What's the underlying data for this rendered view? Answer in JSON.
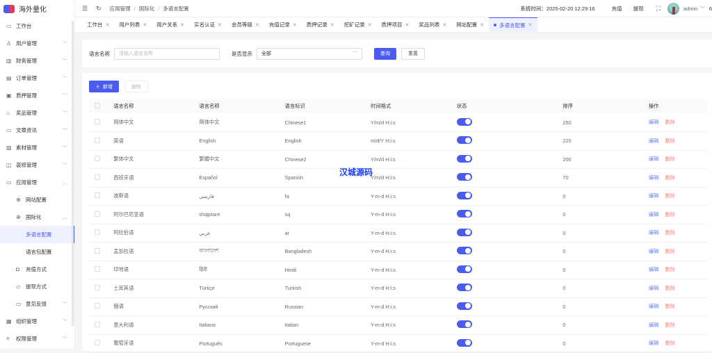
{
  "app": {
    "title": "海外量化"
  },
  "sidebar": {
    "items": [
      {
        "label": "工作台",
        "icon": "monitor-icon",
        "glyph": "▭",
        "level": 1
      },
      {
        "label": "用户管理",
        "icon": "user-icon",
        "glyph": "♙",
        "level": 1,
        "chev": "﹀"
      },
      {
        "label": "财务管理",
        "icon": "finance-icon",
        "glyph": "▥",
        "level": 1,
        "chev": "﹀"
      },
      {
        "label": "订单管理",
        "icon": "order-icon",
        "glyph": "▤",
        "level": 1,
        "chev": "﹀"
      },
      {
        "label": "质押管理",
        "icon": "pledge-icon",
        "glyph": "▣",
        "level": 1,
        "chev": "﹀"
      },
      {
        "label": "奖品管理",
        "icon": "bag-icon",
        "glyph": "⌂",
        "level": 1,
        "chev": "﹀"
      },
      {
        "label": "文章资讯",
        "icon": "article-icon",
        "glyph": "▭",
        "level": 1,
        "chev": "﹀"
      },
      {
        "label": "素材管理",
        "icon": "image-icon",
        "glyph": "▨",
        "level": 1,
        "chev": "﹀"
      },
      {
        "label": "装修管理",
        "icon": "decor-icon",
        "glyph": "◫",
        "level": 1,
        "chev": "﹀"
      },
      {
        "label": "应用管理",
        "icon": "app-icon",
        "glyph": "▭",
        "level": 1,
        "chev": "︿"
      },
      {
        "label": "网站配置",
        "icon": "globe-icon",
        "glyph": "⊕",
        "level": 2
      },
      {
        "label": "国际化",
        "icon": "globe-icon",
        "glyph": "⊕",
        "level": 2,
        "chev": "︿"
      },
      {
        "label": "多语言配置",
        "level": 3,
        "active": true
      },
      {
        "label": "语言包配置",
        "level": 3
      },
      {
        "label": "充值方式",
        "icon": "recharge-icon",
        "glyph": "◘",
        "level": 2
      },
      {
        "label": "提现方式",
        "icon": "folder-icon",
        "glyph": "▱",
        "level": 2
      },
      {
        "label": "意见反馈",
        "icon": "feedback-icon",
        "glyph": "▭",
        "level": 2,
        "chev": "﹀"
      },
      {
        "label": "组织管理",
        "icon": "org-icon",
        "glyph": "▦",
        "level": 1,
        "chev": "﹀"
      },
      {
        "label": "权限管理",
        "icon": "lock-icon",
        "glyph": "⍟",
        "level": 1,
        "chev": "﹀"
      }
    ]
  },
  "header": {
    "breadcrumb": [
      "应用管理",
      "国际化",
      "多语言配置"
    ],
    "system_time_label": "系统时间：",
    "system_time": "2025-02-20 12:29:16",
    "recharge": "充值",
    "withdraw": "提现",
    "user": "admin",
    "cut": "6"
  },
  "tabs": [
    {
      "label": "工作台"
    },
    {
      "label": "用户列表"
    },
    {
      "label": "用户关系"
    },
    {
      "label": "实名认证"
    },
    {
      "label": "会员等级"
    },
    {
      "label": "充值记录"
    },
    {
      "label": "质押记录"
    },
    {
      "label": "挖矿记录"
    },
    {
      "label": "质押项目"
    },
    {
      "label": "奖品列表"
    },
    {
      "label": "网站配置"
    },
    {
      "label": "多语言配置",
      "active": true
    }
  ],
  "search": {
    "name_label": "语言名称",
    "name_placeholder": "请输入语言名称",
    "show_label": "是否显示",
    "show_value": "全部",
    "query": "查询",
    "reset": "重置"
  },
  "toolbar": {
    "add": "新增",
    "delete": "删除"
  },
  "table": {
    "columns": [
      "语言名称",
      "语言名称",
      "语言标识",
      "时间格式",
      "状态",
      "排序",
      "操作"
    ],
    "edit": "编辑",
    "delete": "删除",
    "rows": [
      [
        "简体中文",
        "简体中文",
        "Chinese1",
        "Y/m/d H:i:s",
        true,
        "250"
      ],
      [
        "英语",
        "English",
        "English",
        "m/d/Y H:i:s",
        true,
        "220"
      ],
      [
        "繁体中文",
        "繁體中文",
        "Chinese2",
        "Y/m/d H:i:s",
        true,
        "200"
      ],
      [
        "西班牙语",
        "Español",
        "Spanish",
        "Y/m/d H:i:s",
        true,
        "70"
      ],
      [
        "波斯语",
        "فارسی",
        "fa",
        "Y-m-d H:i:s",
        true,
        "0"
      ],
      [
        "阿尔巴尼亚语",
        "shqiptare",
        "sq",
        "Y-m-d H:i:s",
        true,
        "0"
      ],
      [
        "阿拉伯语",
        "عربي",
        "ar",
        "Y-m-d H:i:s",
        true,
        "0"
      ],
      [
        "孟加拉语",
        "বাংলাদেশ",
        "Bangladesh",
        "Y-m-d H:i:s",
        true,
        "0"
      ],
      [
        "印地语",
        "हिंदी",
        "Hindi",
        "Y-m-d H:i:s",
        true,
        "0"
      ],
      [
        "土耳其语",
        "Türkçe",
        "Turkish",
        "Y-m-d H:i:s",
        true,
        "0"
      ],
      [
        "俄语",
        "Русский",
        "Russian",
        "Y-m-d H:i:s",
        true,
        "0"
      ],
      [
        "意大利语",
        "Italiano",
        "Italian",
        "Y-m-d H:i:s",
        true,
        "0"
      ],
      [
        "葡萄牙语",
        "Português",
        "Portuguese",
        "Y-m-d H:i:s",
        true,
        "0"
      ]
    ]
  },
  "watermark": "汉城源码",
  "colors": {
    "accent": "#4a5cf0",
    "danger": "#f08a8a"
  }
}
